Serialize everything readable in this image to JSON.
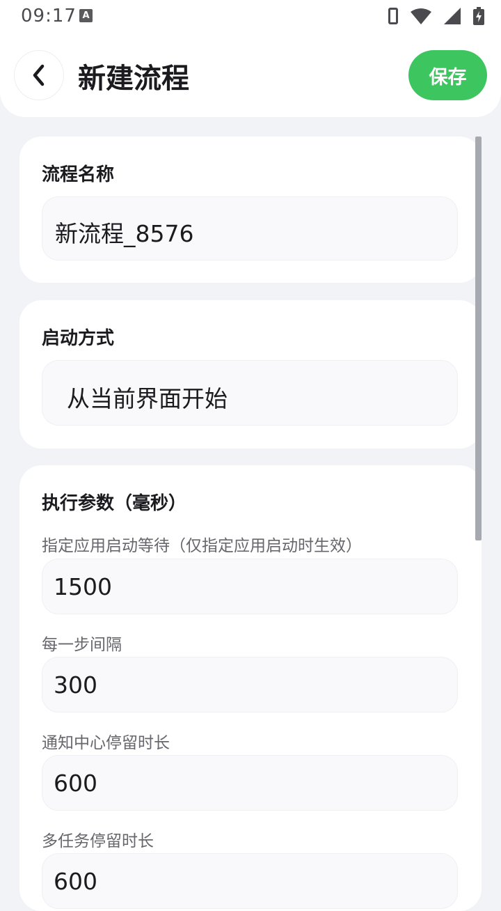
{
  "status_bar": {
    "time": "09:17",
    "notification_icon_letter": "A",
    "icons": [
      "phone-icon",
      "wifi-icon",
      "cell-signal-icon",
      "battery-charging-icon"
    ]
  },
  "header": {
    "back_icon": "chevron-left-icon",
    "title": "新建流程",
    "save_label": "保存"
  },
  "colors": {
    "accent": "#3dc560",
    "background": "#f2f3f7",
    "card": "#ffffff",
    "field": "#f9f9fc"
  },
  "name_section": {
    "label": "流程名称",
    "value": "新流程_8576"
  },
  "start_section": {
    "label": "启动方式",
    "value": "从当前界面开始"
  },
  "params_section": {
    "label": "执行参数（毫秒）",
    "fields": [
      {
        "label": "指定应用启动等待（仅指定应用启动时生效）",
        "value": "1500"
      },
      {
        "label": "每一步间隔",
        "value": "300"
      },
      {
        "label": "通知中心停留时长",
        "value": "600"
      },
      {
        "label": "多任务停留时长",
        "value": "600"
      }
    ]
  }
}
